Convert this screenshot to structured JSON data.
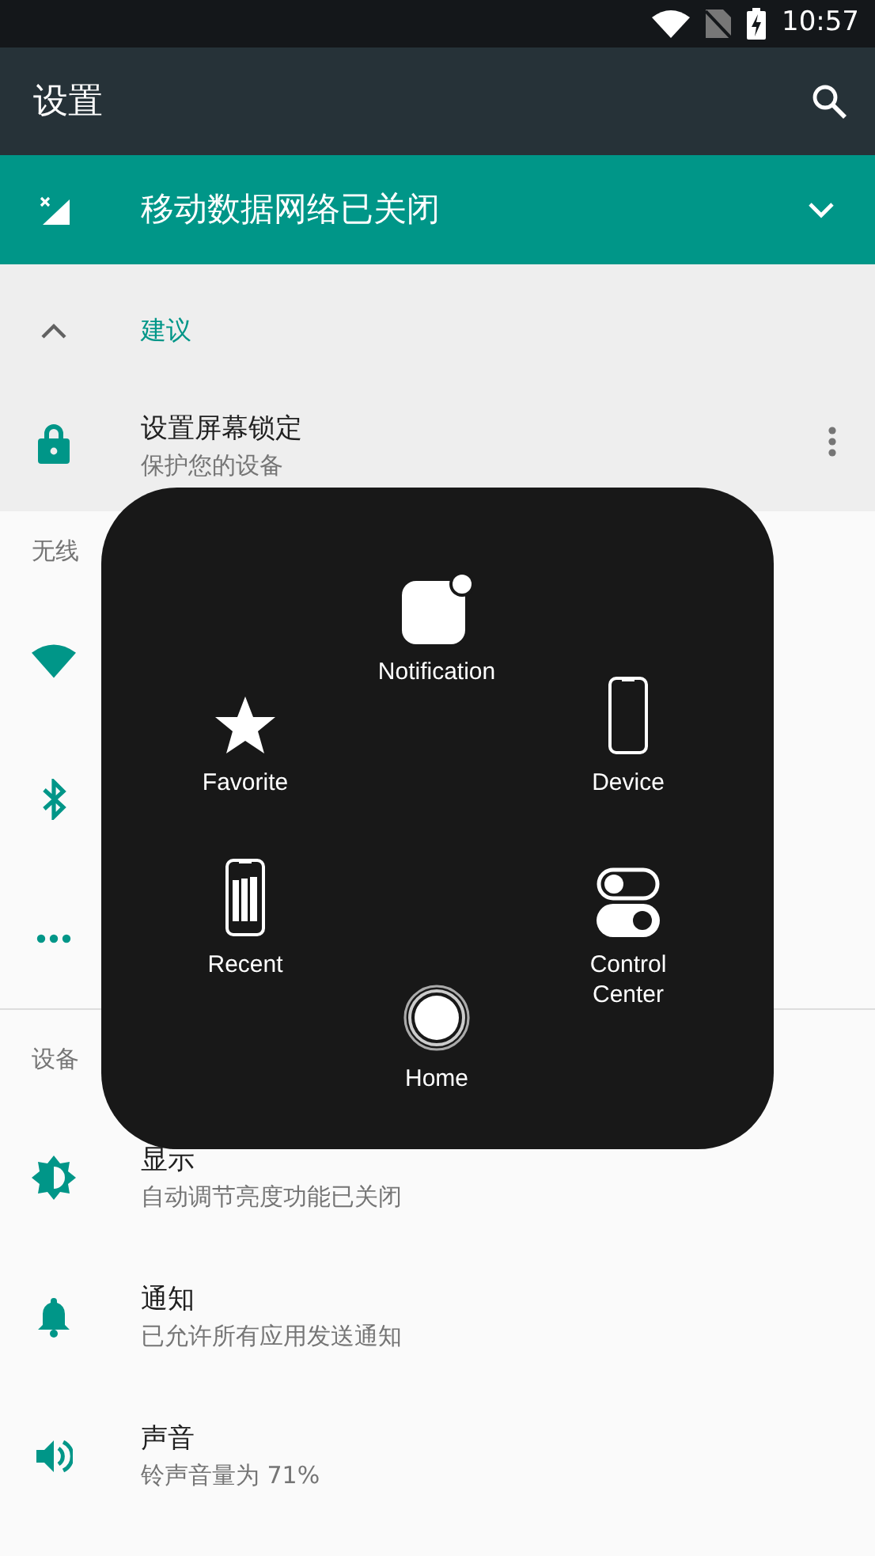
{
  "status_bar": {
    "time": "10:57"
  },
  "app_bar": {
    "title": "设置"
  },
  "banner": {
    "text": "移动数据网络已关闭"
  },
  "suggestions": {
    "header": "建议",
    "items": [
      {
        "kind": "lock",
        "title": "设置屏幕锁定",
        "subtitle": "保护您的设备"
      }
    ]
  },
  "sections": [
    {
      "header": "无线",
      "items": [
        {
          "kind": "wifi"
        },
        {
          "kind": "bluetooth"
        },
        {
          "kind": "more"
        }
      ]
    },
    {
      "header": "设备",
      "items": [
        {
          "kind": "display",
          "title": "显示",
          "subtitle": "自动调节亮度功能已关闭"
        },
        {
          "kind": "bell",
          "title": "通知",
          "subtitle": "已允许所有应用发送通知"
        },
        {
          "kind": "sound",
          "title": "声音",
          "subtitle": "铃声音量为 71%"
        }
      ]
    }
  ],
  "assistive_menu": {
    "items": [
      {
        "kind": "notification",
        "label": "Notification"
      },
      {
        "kind": "favorite",
        "label": "Favorite"
      },
      {
        "kind": "device",
        "label": "Device"
      },
      {
        "kind": "recent",
        "label": "Recent"
      },
      {
        "kind": "control",
        "label": "Control Center"
      },
      {
        "kind": "home",
        "label": "Home"
      }
    ]
  }
}
